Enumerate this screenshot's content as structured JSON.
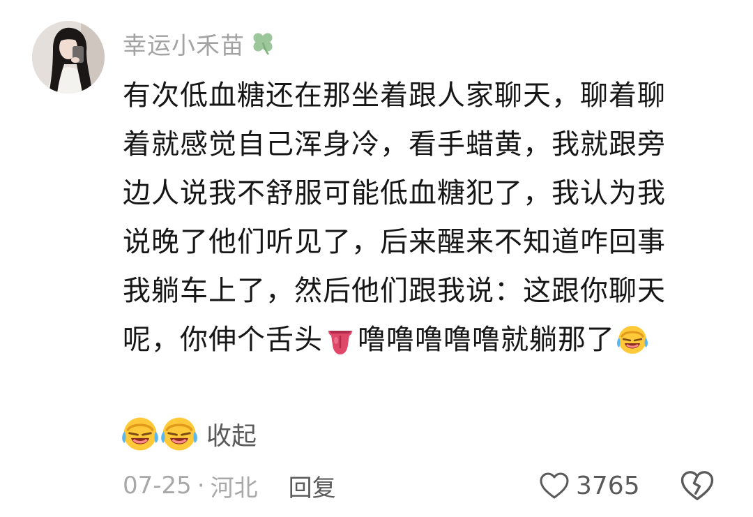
{
  "comment": {
    "username": "幸运小禾苗",
    "username_badge_icon": "four-leaf-clover-icon",
    "lines": [
      "有次低血糖还在那坐着跟人家聊天，聊着聊",
      "着就感觉自己浑身冷，看手蜡黄，我就跟旁",
      "边人说我不舒服可能低血糖犯了，我认为我",
      "说晚了他们听见了，后来醒来不知道咋回事",
      "我躺车上了，然后他们跟我说：这跟你聊天"
    ],
    "last_line": {
      "part1": "呢，你伸个舌头",
      "part2": "噜噜噜噜噜就躺那了"
    },
    "collapse_label": "收起",
    "date": "07-25",
    "separator": "·",
    "location": "河北",
    "reply_label": "回复",
    "like_count": "3765",
    "colors": {
      "meta_gray": "#a8a8a8",
      "text": "#161616",
      "action_gray": "#5a5a5a"
    }
  }
}
